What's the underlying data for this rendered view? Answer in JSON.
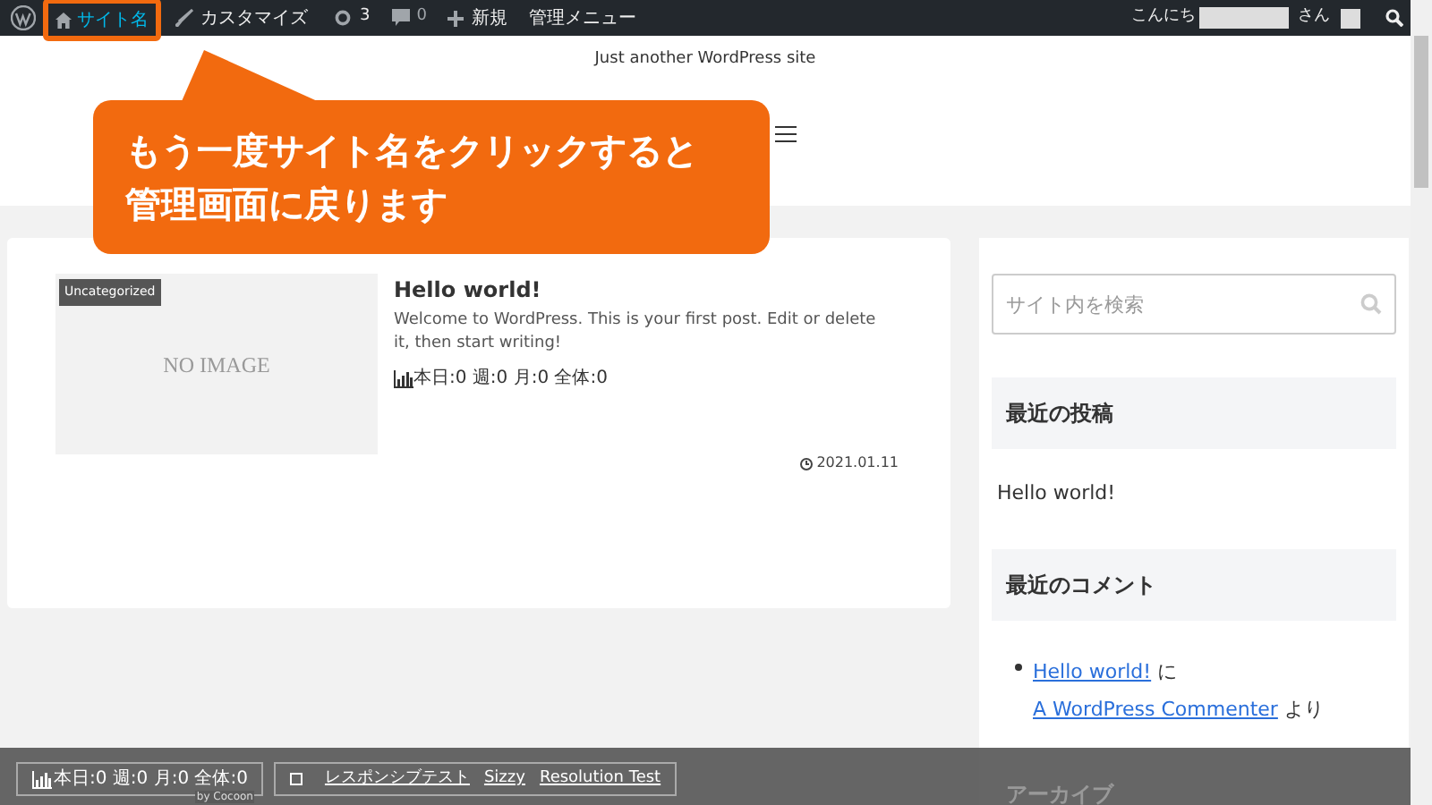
{
  "admin_bar": {
    "items": [
      {
        "kind": "logo"
      },
      {
        "kind": "site",
        "label": "サイト名",
        "selected": true
      },
      {
        "kind": "brush",
        "label": "カスタマイズ"
      },
      {
        "kind": "updates",
        "label": "3"
      },
      {
        "kind": "comments",
        "label": "0"
      },
      {
        "kind": "new",
        "label": "新規"
      },
      {
        "kind": "text",
        "label": "管理メニュー"
      }
    ],
    "greeting": "こんにち",
    "greeting_suffix": "さん"
  },
  "header": {
    "tagline": "Just another WordPress site"
  },
  "callout": {
    "lines": [
      "もう一度サイト名をクリックすると",
      "管理画面に戻ります"
    ]
  },
  "post": {
    "category": "Uncategorized",
    "no_image": "NO IMAGE",
    "title": "Hello world!",
    "excerpt": "Welcome to WordPress. This is your first post. Edit or delete it, then start writing!",
    "stats": "本日:0 週:0 月:0 全体:0",
    "date": "2021.01.11"
  },
  "sidebar": {
    "search": {
      "placeholder": "サイト内を検索"
    },
    "recent_posts": {
      "title": "最近の投稿",
      "items": [
        "Hello world!"
      ]
    },
    "recent_comments": {
      "title": "最近のコメント",
      "post": "Hello world!",
      "on": "に",
      "author": "A WordPress Commenter",
      "by": "より"
    },
    "archive_title": "アーカイブ"
  },
  "bottom_bar": {
    "stats": "本日:0 週:0 月:0 全体:0",
    "by": "by Cocoon",
    "links": [
      "レスポンシブテスト",
      "Sizzy",
      "Resolution Test"
    ]
  }
}
